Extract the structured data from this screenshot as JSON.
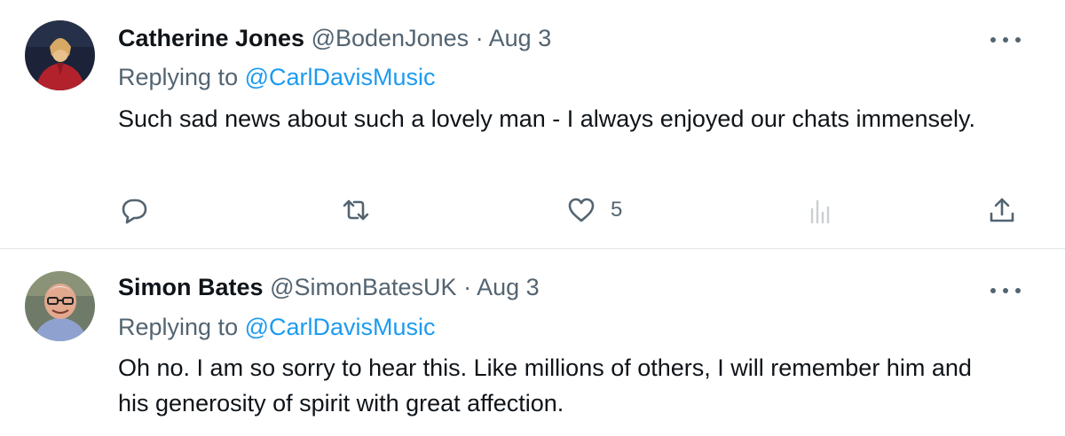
{
  "tweets": [
    {
      "name": "Catherine Jones",
      "handle": "@BodenJones",
      "separator": "·",
      "date": "Aug 3",
      "replying_prefix": "Replying to ",
      "replying_to": "@CarlDavisMusic",
      "body": "Such sad news about such a lovely man - I always enjoyed our chats immensely.",
      "like_count": "5"
    },
    {
      "name": "Simon Bates",
      "handle": "@SimonBatesUK",
      "separator": "·",
      "date": "Aug 3",
      "replying_prefix": "Replying to ",
      "replying_to": "@CarlDavisMusic",
      "body": "Oh no. I am so sorry to hear this. Like millions of others, I will remember him and his generosity of spirit with great affection."
    }
  ],
  "icons": {
    "more": "more-horizontal-icon",
    "reply": "reply-bubble-icon",
    "retweet": "retweet-icon",
    "like": "heart-icon",
    "views": "analytics-bars-icon",
    "share": "share-upload-icon"
  },
  "colors": {
    "text_primary": "#0f1419",
    "text_secondary": "#536471",
    "mention_link": "#1d9bf0",
    "divider": "#e3e6e8"
  }
}
